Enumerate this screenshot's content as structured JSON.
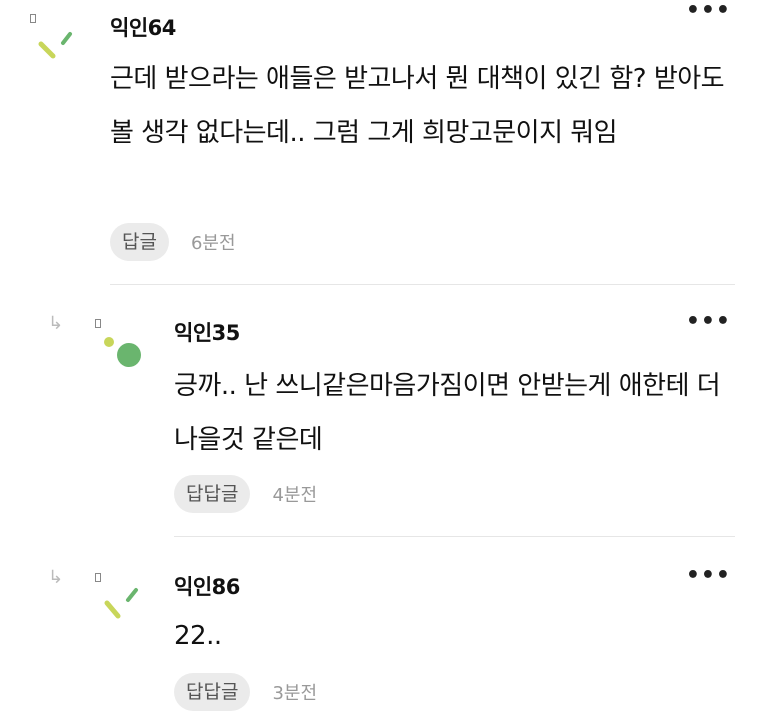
{
  "comments": [
    {
      "author": "익인64",
      "body": "근데 받으라는 애들은 받고나서 뭔 대책이 있긴 함? 받아도 볼 생각 없다는데.. 그럼 그게 희망고문이지 뭐임",
      "reply_label": "답글",
      "time": "6분전",
      "more_label": "•••",
      "avatar_icon": "confetti-avatar-icon"
    },
    {
      "author": "익인35",
      "body": "긍까.. 난 쓰니같은마음가짐이면 안받는게 애한테 더 나을것 같은데",
      "reply_label": "답답글",
      "time": "4분전",
      "more_label": "•••",
      "avatar_icon": "green-dot-avatar-icon"
    },
    {
      "author": "익인86",
      "body": "22..",
      "reply_label": "답답글",
      "time": "3분전",
      "more_label": "•••",
      "avatar_icon": "confetti-avatar-icon"
    }
  ],
  "reply_arrow_icon": "reply-arrow-icon",
  "colors": {
    "accent_green": "#6ab56e",
    "avatar_yellow": "#c8d65a",
    "button_bg": "#ebebeb",
    "time_gray": "#999999"
  }
}
